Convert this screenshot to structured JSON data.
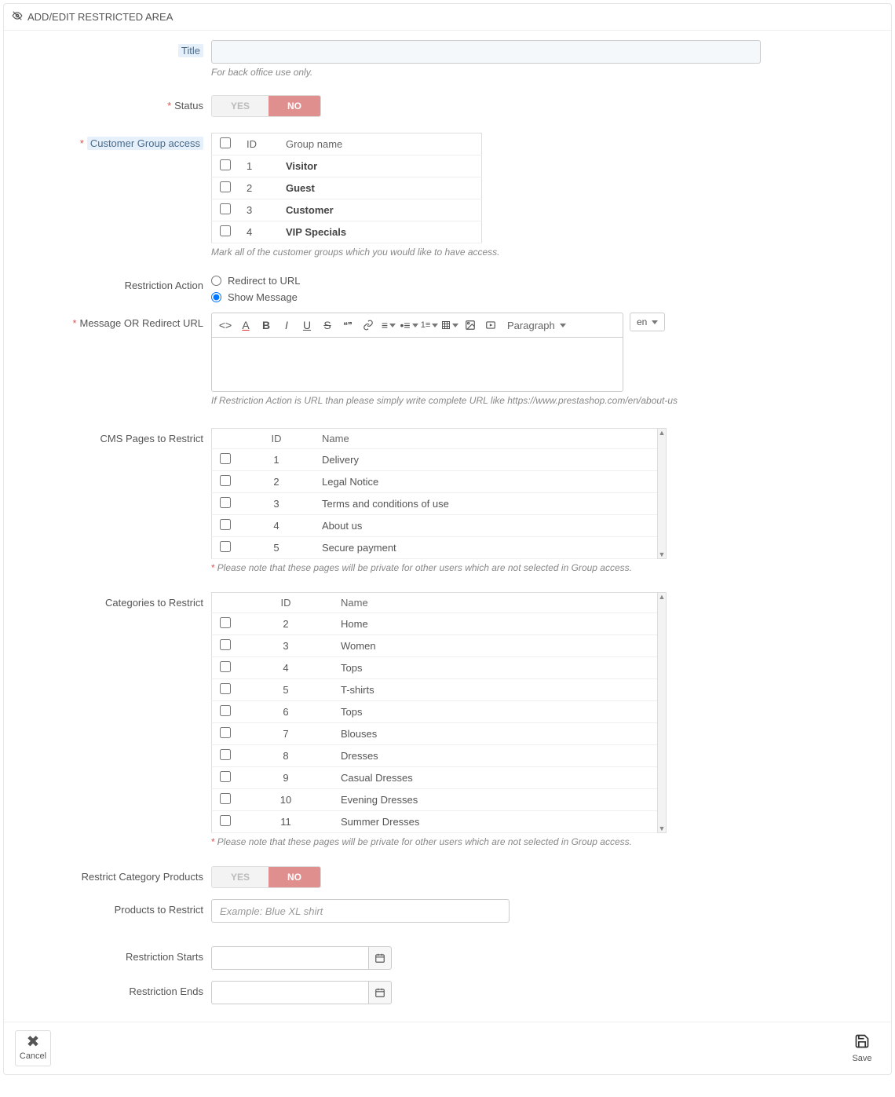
{
  "header": {
    "title": "ADD/EDIT RESTRICTED AREA"
  },
  "fields": {
    "title": {
      "label": "Title",
      "help": "For back office use only."
    },
    "status": {
      "label": "Status",
      "yes": "YES",
      "no": "NO"
    },
    "group_access": {
      "label": "Customer Group access",
      "columns": {
        "id": "ID",
        "name": "Group name"
      },
      "rows": [
        {
          "id": "1",
          "name": "Visitor"
        },
        {
          "id": "2",
          "name": "Guest"
        },
        {
          "id": "3",
          "name": "Customer"
        },
        {
          "id": "4",
          "name": "VIP Specials"
        }
      ],
      "help": "Mark all of the customer groups which you would like to have access."
    },
    "restriction_action": {
      "label": "Restriction Action",
      "options": {
        "redirect": "Redirect to URL",
        "message": "Show Message"
      }
    },
    "message": {
      "label": "Message OR Redirect URL",
      "paragraph": "Paragraph",
      "lang": "en",
      "help": "If Restriction Action is URL than please simply write complete URL like https://www.prestashop.com/en/about-us"
    },
    "cms": {
      "label": "CMS Pages to Restrict",
      "columns": {
        "id": "ID",
        "name": "Name"
      },
      "rows": [
        {
          "id": "1",
          "name": "Delivery"
        },
        {
          "id": "2",
          "name": "Legal Notice"
        },
        {
          "id": "3",
          "name": "Terms and conditions of use"
        },
        {
          "id": "4",
          "name": "About us"
        },
        {
          "id": "5",
          "name": "Secure payment"
        }
      ],
      "note": "Please note that these pages will be private for other users which are not selected in Group access."
    },
    "categories": {
      "label": "Categories to Restrict",
      "columns": {
        "id": "ID",
        "name": "Name"
      },
      "rows": [
        {
          "id": "2",
          "name": "Home"
        },
        {
          "id": "3",
          "name": "Women"
        },
        {
          "id": "4",
          "name": "Tops"
        },
        {
          "id": "5",
          "name": "T-shirts"
        },
        {
          "id": "6",
          "name": "Tops"
        },
        {
          "id": "7",
          "name": "Blouses"
        },
        {
          "id": "8",
          "name": "Dresses"
        },
        {
          "id": "9",
          "name": "Casual Dresses"
        },
        {
          "id": "10",
          "name": "Evening Dresses"
        },
        {
          "id": "11",
          "name": "Summer Dresses"
        }
      ],
      "note": "Please note that these pages will be private for other users which are not selected in Group access."
    },
    "restrict_products_toggle": {
      "label": "Restrict Category Products",
      "yes": "YES",
      "no": "NO"
    },
    "products": {
      "label": "Products to Restrict",
      "placeholder": "Example: Blue XL shirt"
    },
    "starts": {
      "label": "Restriction Starts"
    },
    "ends": {
      "label": "Restriction Ends"
    }
  },
  "footer": {
    "cancel": "Cancel",
    "save": "Save"
  }
}
